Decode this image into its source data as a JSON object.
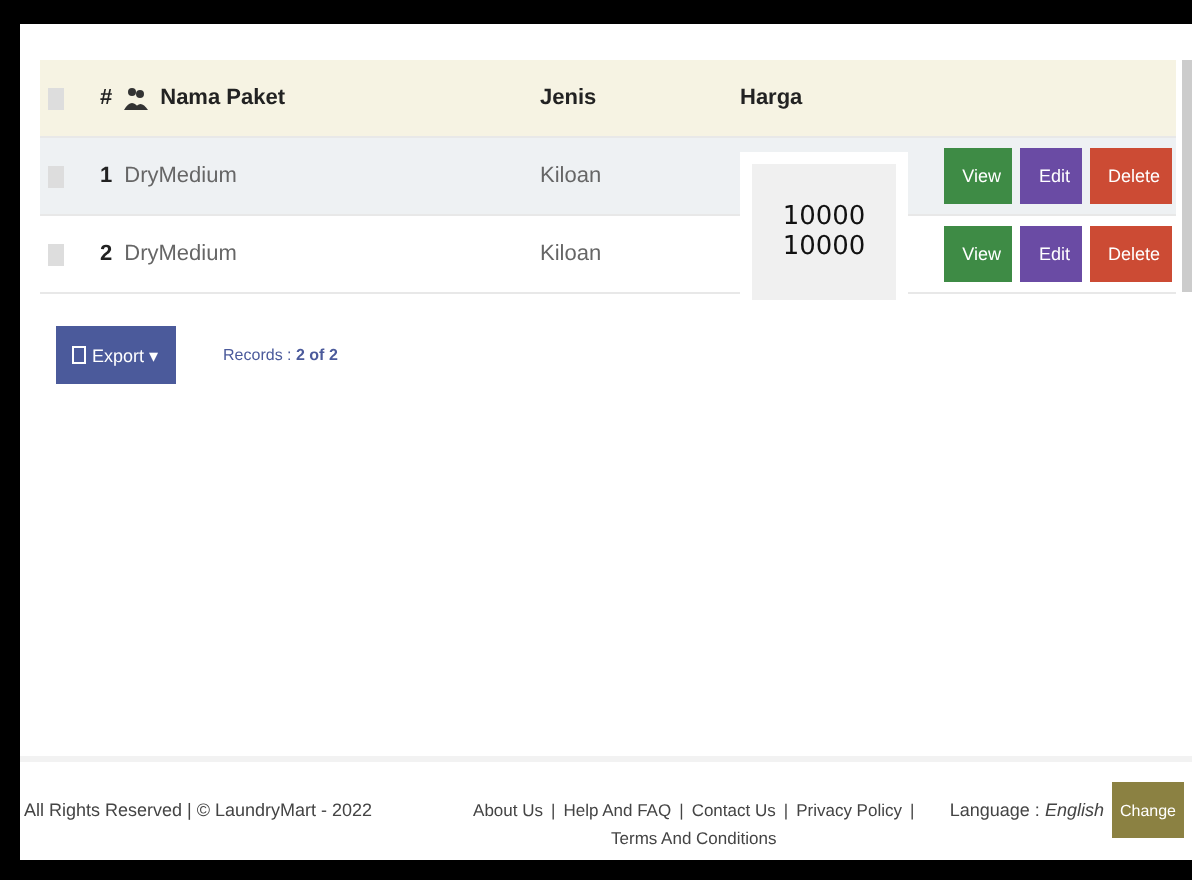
{
  "table": {
    "header_checked": false,
    "columns": [
      "#",
      "Nama Paket",
      "Jenis",
      "Harga"
    ],
    "rows": [
      {
        "checked": false,
        "no": "1",
        "nama": "DryMedium",
        "jenis": "Kiloan",
        "harga": "10000",
        "actions": [
          "View",
          "Edit",
          "Delete"
        ]
      },
      {
        "checked": false,
        "no": "2",
        "nama": "DryMedium",
        "jenis": "Kiloan",
        "harga": "10000",
        "actions": [
          "View",
          "Edit",
          "Delete"
        ]
      }
    ]
  },
  "export": {
    "label": "Export",
    "caret": "▾"
  },
  "records": {
    "label": "Records :",
    "value": "2 of 2"
  },
  "footer": {
    "copyright": "All Rights Reserved | © LaundryMart - 2022",
    "separator": "|",
    "links": [
      "About Us",
      "Help And FAQ",
      "Contact Us",
      "Privacy Policy",
      "Terms And Conditions"
    ],
    "language_label": "Language :",
    "language": "English",
    "change": "Change"
  }
}
